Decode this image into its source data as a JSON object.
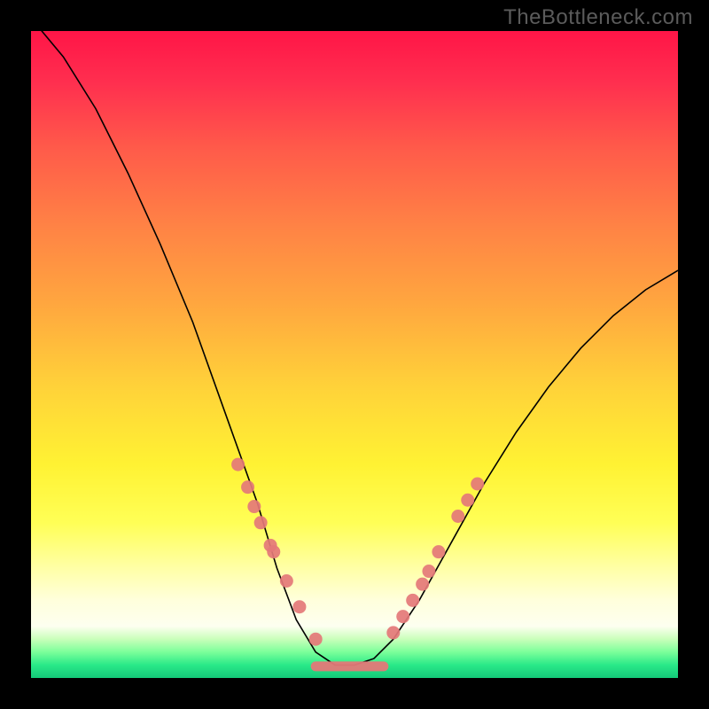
{
  "watermark": "TheBottleneck.com",
  "colors": {
    "curve": "#000000",
    "dots": "#e47878",
    "gradient_top": "#ff1547",
    "gradient_mid": "#fff233",
    "gradient_bottom": "#14c979"
  },
  "chart_data": {
    "type": "line",
    "title": "",
    "xlabel": "",
    "ylabel": "",
    "xlim": [
      0,
      1
    ],
    "ylim": [
      0,
      1
    ],
    "grid": false,
    "series": [
      {
        "name": "bottleneck-curve",
        "x": [
          0.0,
          0.05,
          0.1,
          0.15,
          0.2,
          0.25,
          0.3,
          0.35,
          0.38,
          0.41,
          0.44,
          0.47,
          0.5,
          0.53,
          0.56,
          0.6,
          0.65,
          0.7,
          0.75,
          0.8,
          0.85,
          0.9,
          0.95,
          1.0
        ],
        "y": [
          1.02,
          0.96,
          0.88,
          0.78,
          0.67,
          0.55,
          0.41,
          0.27,
          0.17,
          0.09,
          0.04,
          0.02,
          0.02,
          0.03,
          0.06,
          0.12,
          0.21,
          0.3,
          0.38,
          0.45,
          0.51,
          0.56,
          0.6,
          0.63
        ]
      }
    ],
    "markers": [
      {
        "name": "left-cluster",
        "x": [
          0.32,
          0.335,
          0.345,
          0.355,
          0.37,
          0.375,
          0.395,
          0.415,
          0.44
        ],
        "y": [
          0.33,
          0.295,
          0.265,
          0.24,
          0.205,
          0.195,
          0.15,
          0.11,
          0.06
        ]
      },
      {
        "name": "right-cluster",
        "x": [
          0.56,
          0.575,
          0.59,
          0.605,
          0.615,
          0.63,
          0.66,
          0.675,
          0.69
        ],
        "y": [
          0.07,
          0.095,
          0.12,
          0.145,
          0.165,
          0.195,
          0.25,
          0.275,
          0.3
        ]
      }
    ],
    "flat_segment": {
      "x0": 0.44,
      "x1": 0.545,
      "y": 0.018
    }
  }
}
